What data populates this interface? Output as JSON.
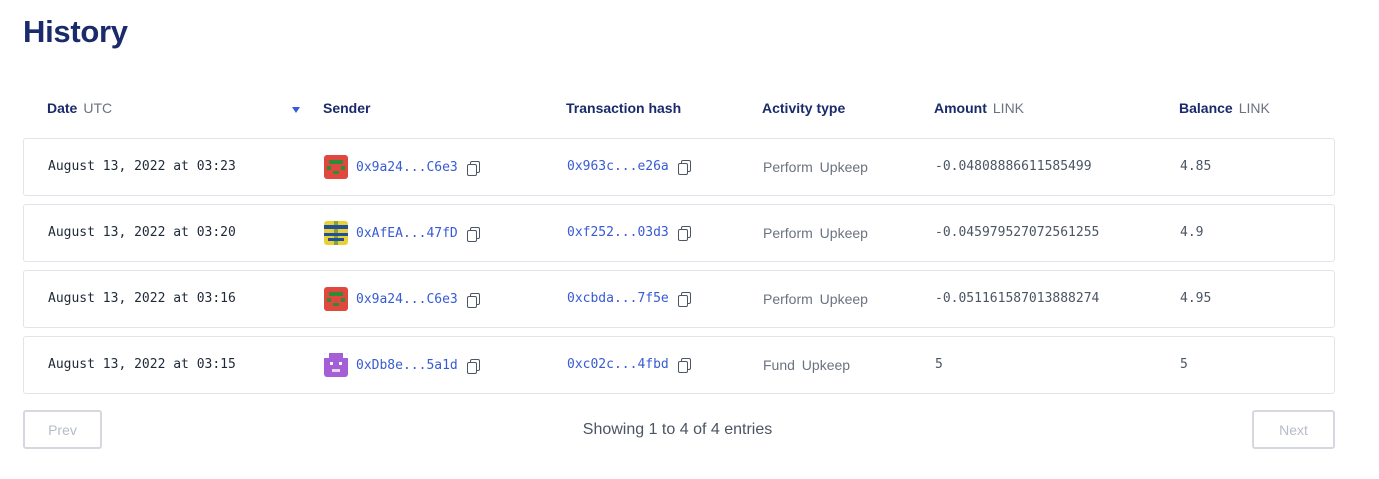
{
  "page": {
    "title": "History"
  },
  "table": {
    "columns": [
      {
        "label": "Date",
        "unit": "UTC"
      },
      {
        "label": "Sender",
        "unit": ""
      },
      {
        "label": "Transaction hash",
        "unit": ""
      },
      {
        "label": "Activity type",
        "unit": ""
      },
      {
        "label": "Amount",
        "unit": "LINK"
      },
      {
        "label": "Balance",
        "unit": "LINK"
      }
    ],
    "rows": [
      {
        "date": "August 13, 2022 at 03:23",
        "sender": "0x9a24...C6e3",
        "avatar": "red",
        "hash": "0x963c...e26a",
        "activity": "Perform Upkeep",
        "amount": "-0.04808886611585499",
        "balance": "4.85"
      },
      {
        "date": "August 13, 2022 at 03:20",
        "sender": "0xAfEA...47fD",
        "avatar": "yellow",
        "hash": "0xf252...03d3",
        "activity": "Perform Upkeep",
        "amount": "-0.045979527072561255",
        "balance": "4.9"
      },
      {
        "date": "August 13, 2022 at 03:16",
        "sender": "0x9a24...C6e3",
        "avatar": "red",
        "hash": "0xcbda...7f5e",
        "activity": "Perform Upkeep",
        "amount": "-0.051161587013888274",
        "balance": "4.95"
      },
      {
        "date": "August 13, 2022 at 03:15",
        "sender": "0xDb8e...5a1d",
        "avatar": "purple",
        "hash": "0xc02c...4fbd",
        "activity": "Fund Upkeep",
        "amount": "5",
        "balance": "5"
      }
    ]
  },
  "pagination": {
    "prev_label": "Prev",
    "next_label": "Next",
    "summary": "Showing 1 to 4 of 4 entries"
  },
  "colors": {
    "heading": "#1a2b6b",
    "link": "#375bd2",
    "border": "#e2e4ea"
  },
  "icons": {
    "copy": "copy-icon",
    "sort": "sort-down-icon"
  }
}
